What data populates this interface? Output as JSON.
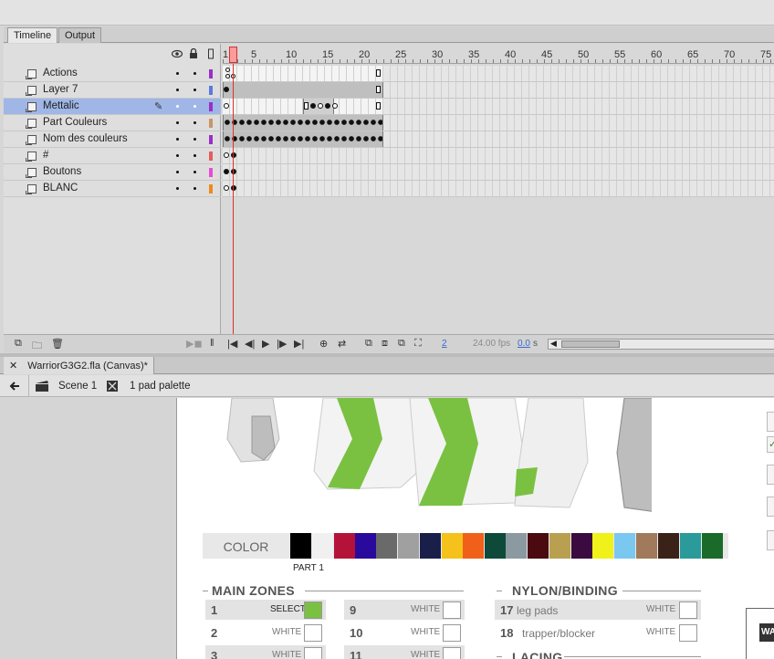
{
  "panel": {
    "tabs": [
      {
        "label": "Timeline"
      },
      {
        "label": "Output"
      }
    ]
  },
  "layers": [
    {
      "name": "Actions",
      "color": "#9b2fc6"
    },
    {
      "name": "Layer 7",
      "color": "#5a7ae0"
    },
    {
      "name": "Mettalic",
      "color": "#9b2fc6",
      "selected": true
    },
    {
      "name": "Part Couleurs",
      "color": "#c8956a"
    },
    {
      "name": "Nom des couleurs",
      "color": "#9b2fc6"
    },
    {
      "name": "#",
      "color": "#e85b5b"
    },
    {
      "name": "Boutons",
      "color": "#e84ad8"
    },
    {
      "name": "BLANC",
      "color": "#f08a1a"
    }
  ],
  "ruler": {
    "labels": [
      "1",
      "5",
      "10",
      "15",
      "20",
      "25",
      "30",
      "35",
      "40",
      "45",
      "50",
      "55",
      "60",
      "65",
      "70",
      "75"
    ]
  },
  "footer": {
    "current_frame": "2",
    "fps": "24.00 fps",
    "time_value": "0.0",
    "time_unit": "s"
  },
  "document": {
    "tab_title": "WarriorG3G2.fla (Canvas)*",
    "scene": "Scene 1",
    "symbol": "1 pad palette"
  },
  "stage": {
    "color_label": "COLOR",
    "part_label": "PART 1",
    "swatches": [
      "#000000",
      "#f0f0f0",
      "#b5123a",
      "#2a0a9c",
      "#6a6a6a",
      "#a0a0a0",
      "#1a1f4a",
      "#f4c21a",
      "#f0601a",
      "#0e4a3a",
      "#8a9aa0",
      "#4a0a10",
      "#b8a050",
      "#3a0a40",
      "#f0f01a",
      "#7ac8f0",
      "#a07a5a",
      "#3a2218",
      "#2a9a9a",
      "#1a6a2a"
    ],
    "main_zones_title": "MAIN ZONES",
    "nylon_title": "NYLON/BINDING",
    "lacing_title": "LACING",
    "zones_col1": [
      {
        "num": "1",
        "value": "SELECT",
        "fill": "#7ac142"
      },
      {
        "num": "2",
        "value": "WHITE",
        "fill": "#ffffff"
      },
      {
        "num": "3",
        "value": "WHITE",
        "fill": "#ffffff"
      }
    ],
    "zones_col2": [
      {
        "num": "9",
        "value": "WHITE"
      },
      {
        "num": "10",
        "value": "WHITE"
      },
      {
        "num": "11",
        "value": "WHITE"
      }
    ],
    "nylon_rows": [
      {
        "num": "17",
        "label": "leg pads",
        "value": "WHITE"
      },
      {
        "num": "18",
        "label": "trapper/blocker",
        "value": "WHITE"
      }
    ],
    "side_text": "WA"
  }
}
